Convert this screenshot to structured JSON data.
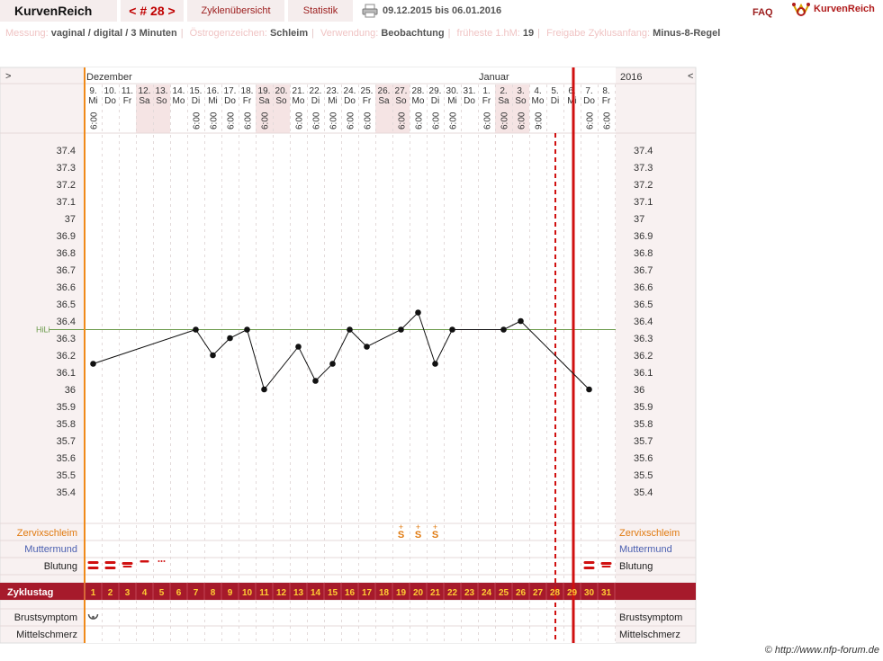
{
  "header": {
    "app_title": "KurvenReich",
    "cycle_nav": "< # 28 >",
    "tab_overview": "Zyklenübersicht",
    "tab_stats": "Statistik",
    "date_range": "09.12.2015 bis 06.01.2016",
    "faq": "FAQ",
    "logo_text": "KurvenReich"
  },
  "meta": {
    "messung_label": "Messung:",
    "messung_value": "vaginal / digital / 3 Minuten",
    "oestrogen_label": "Östrogenzeichen:",
    "oestrogen_value": "Schleim",
    "verwendung_label": "Verwendung:",
    "verwendung_value": "Beobachtung",
    "frueheste_label": "früheste 1.hM:",
    "frueheste_value": "19",
    "freigabe_label": "Freigabe Zyklusanfang:",
    "freigabe_value": "Minus-8-Regel"
  },
  "chart_head": {
    "left_arrow": ">",
    "right_arrow": "<",
    "month_dec": "Dezember",
    "month_jan": "Januar",
    "year": "2016"
  },
  "days": [
    {
      "d": "9.",
      "w": "Mi",
      "t": "6:00",
      "we": false
    },
    {
      "d": "10.",
      "w": "Do",
      "t": "",
      "we": false
    },
    {
      "d": "11.",
      "w": "Fr",
      "t": "",
      "we": false
    },
    {
      "d": "12.",
      "w": "Sa",
      "t": "",
      "we": true
    },
    {
      "d": "13.",
      "w": "So",
      "t": "",
      "we": true
    },
    {
      "d": "14.",
      "w": "Mo",
      "t": "",
      "we": false
    },
    {
      "d": "15.",
      "w": "Di",
      "t": "6:00",
      "we": false
    },
    {
      "d": "16.",
      "w": "Mi",
      "t": "6:00",
      "we": false
    },
    {
      "d": "17.",
      "w": "Do",
      "t": "6:00",
      "we": false
    },
    {
      "d": "18.",
      "w": "Fr",
      "t": "6:00",
      "we": false
    },
    {
      "d": "19.",
      "w": "Sa",
      "t": "6:00",
      "we": true
    },
    {
      "d": "20.",
      "w": "So",
      "t": "",
      "we": true
    },
    {
      "d": "21.",
      "w": "Mo",
      "t": "6:00",
      "we": false
    },
    {
      "d": "22.",
      "w": "Di",
      "t": "6:00",
      "we": false
    },
    {
      "d": "23.",
      "w": "Mi",
      "t": "6:00",
      "we": false
    },
    {
      "d": "24.",
      "w": "Do",
      "t": "6:00",
      "we": false
    },
    {
      "d": "25.",
      "w": "Fr",
      "t": "6:00",
      "we": false
    },
    {
      "d": "26.",
      "w": "Sa",
      "t": "",
      "we": true
    },
    {
      "d": "27.",
      "w": "So",
      "t": "6:00",
      "we": true
    },
    {
      "d": "28.",
      "w": "Mo",
      "t": "6:00",
      "we": false
    },
    {
      "d": "29.",
      "w": "Di",
      "t": "6:00",
      "we": false
    },
    {
      "d": "30.",
      "w": "Mi",
      "t": "6:00",
      "we": false
    },
    {
      "d": "31.",
      "w": "Do",
      "t": "",
      "we": false
    },
    {
      "d": "1.",
      "w": "Fr",
      "t": "6:00",
      "we": false
    },
    {
      "d": "2.",
      "w": "Sa",
      "t": "6:00",
      "we": true
    },
    {
      "d": "3.",
      "w": "So",
      "t": "6:00",
      "we": true
    },
    {
      "d": "4.",
      "w": "Mo",
      "t": "9:00",
      "we": false
    },
    {
      "d": "5.",
      "w": "Di",
      "t": "",
      "we": false
    },
    {
      "d": "6.",
      "w": "Mi",
      "t": "",
      "we": false
    },
    {
      "d": "7.",
      "w": "Do",
      "t": "6:00",
      "we": false
    },
    {
      "d": "8.",
      "w": "Fr",
      "t": "6:00",
      "we": false
    }
  ],
  "y_ticks": [
    "37.4",
    "37.3",
    "37.2",
    "37.1",
    "37",
    "36.9",
    "36.8",
    "36.7",
    "36.6",
    "36.5",
    "36.4",
    "36.3",
    "36.2",
    "36.1",
    "36",
    "35.9",
    "35.8",
    "35.7",
    "35.6",
    "35.5",
    "35.4"
  ],
  "hili_label": "HiLi",
  "hili_value": 36.35,
  "rows": {
    "zervix": "Zervixschleim",
    "muttermund": "Muttermund",
    "blutung": "Blutung",
    "zyklustag": "Zyklustag",
    "brust": "Brustsymptom",
    "mittel": "Mittelschmerz"
  },
  "zervix_marks": [
    {
      "day": 19,
      "symbol": "S+"
    },
    {
      "day": 20,
      "symbol": "S+"
    },
    {
      "day": 21,
      "symbol": "S+"
    }
  ],
  "bleeding": [
    {
      "day": 1,
      "level": "heavy"
    },
    {
      "day": 2,
      "level": "heavy"
    },
    {
      "day": 3,
      "level": "medium"
    },
    {
      "day": 4,
      "level": "light"
    },
    {
      "day": 5,
      "level": "spotting"
    },
    {
      "day": 30,
      "level": "heavy"
    },
    {
      "day": 31,
      "level": "medium"
    }
  ],
  "brust_marks": [
    {
      "day": 1,
      "symbol": "breast-icon"
    }
  ],
  "cycle_days": [
    "1",
    "2",
    "3",
    "4",
    "5",
    "6",
    "7",
    "8",
    "9",
    "10",
    "11",
    "12",
    "13",
    "14",
    "15",
    "16",
    "17",
    "18",
    "19",
    "20",
    "21",
    "22",
    "23",
    "24",
    "25",
    "26",
    "27",
    "28",
    "29",
    "30",
    "31"
  ],
  "copyright": "© http://www.nfp-forum.de",
  "chart_data": {
    "type": "line",
    "title": "",
    "xlabel": "Zyklustag",
    "ylabel": "",
    "ylim": [
      35.4,
      37.4
    ],
    "series": [
      {
        "name": "",
        "points": [
          {
            "x": 1,
            "y": 36.15
          },
          {
            "x": 7,
            "y": 36.35
          },
          {
            "x": 8,
            "y": 36.2
          },
          {
            "x": 9,
            "y": 36.3
          },
          {
            "x": 10,
            "y": 36.35
          },
          {
            "x": 11,
            "y": 36.0
          },
          {
            "x": 13,
            "y": 36.25
          },
          {
            "x": 14,
            "y": 36.05
          },
          {
            "x": 15,
            "y": 36.15
          },
          {
            "x": 16,
            "y": 36.35
          },
          {
            "x": 17,
            "y": 36.25
          },
          {
            "x": 19,
            "y": 36.35
          },
          {
            "x": 20,
            "y": 36.45
          },
          {
            "x": 21,
            "y": 36.15
          },
          {
            "x": 22,
            "y": 36.35
          },
          {
            "x": 25,
            "y": 36.35
          },
          {
            "x": 26,
            "y": 36.4
          },
          {
            "x": 30,
            "y": 36.0
          }
        ]
      }
    ],
    "hili": 36.35,
    "evaluation_line_day": 29,
    "cycle_end_day": 29
  }
}
